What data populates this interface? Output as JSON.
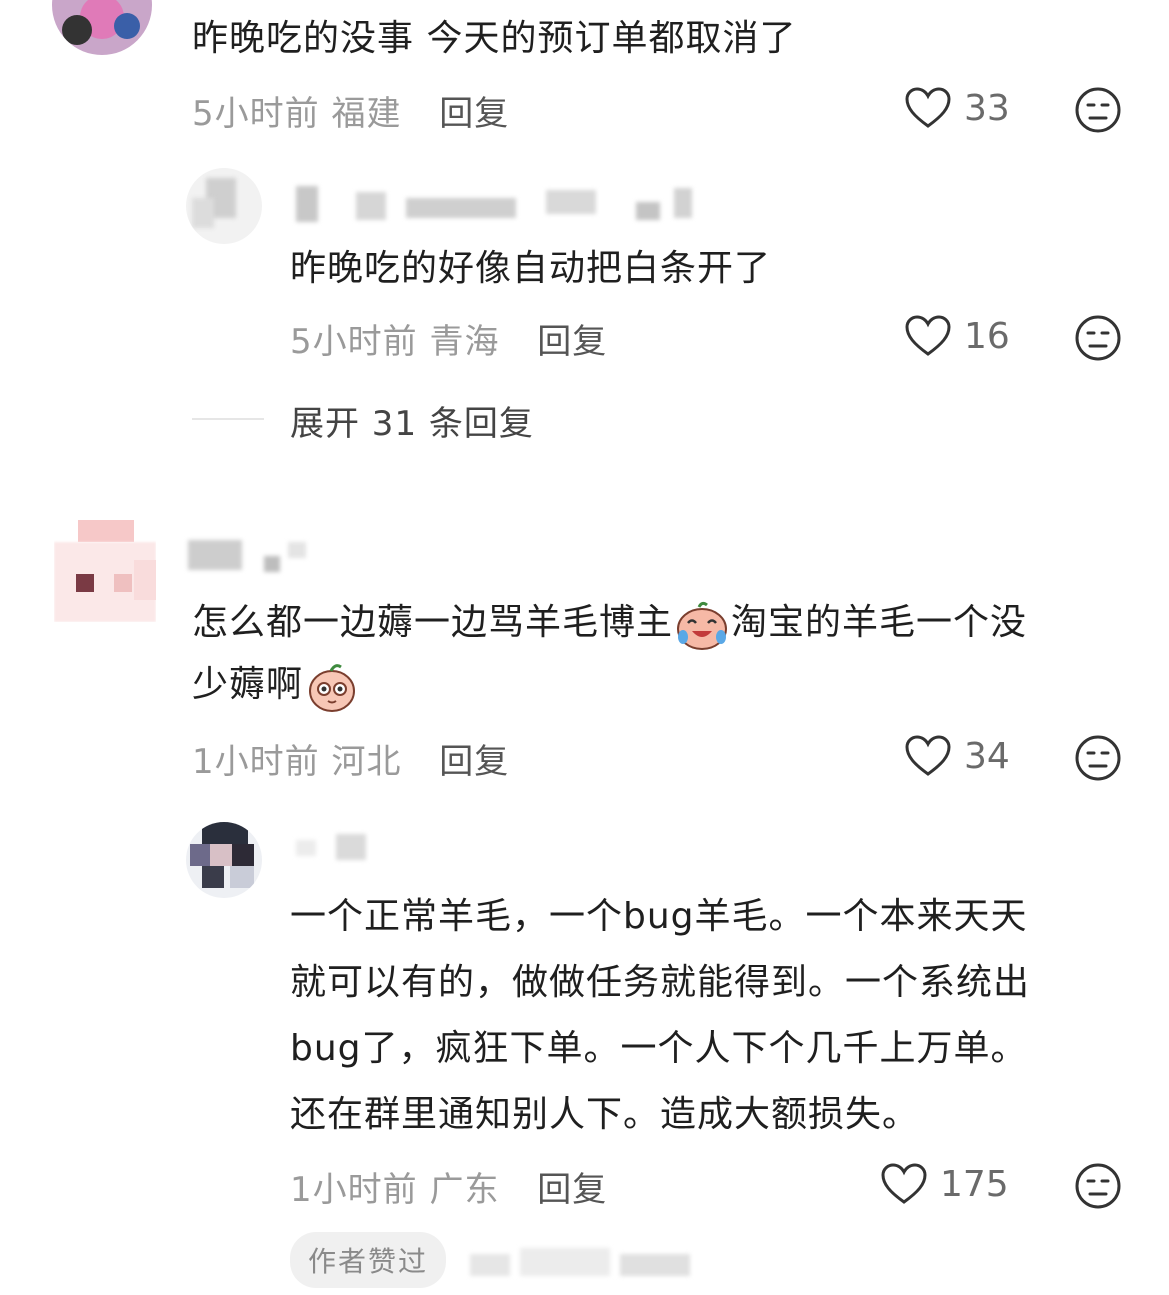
{
  "comments": [
    {
      "text": "昨晚吃的没事 今天的预订单都取消了",
      "time": "5小时前",
      "location": "福建",
      "reply": "回复",
      "likes": "33"
    },
    {
      "text": "昨晚吃的好像自动把白条开了",
      "time": "5小时前",
      "location": "青海",
      "reply": "回复",
      "likes": "16"
    },
    {
      "text_line1": "怎么都一边薅一边骂羊毛博主",
      "text_line1b": "淘宝的羊毛一个没",
      "text_line2": "少薅啊",
      "time": "1小时前",
      "location": "河北",
      "reply": "回复",
      "likes": "34"
    },
    {
      "lines": [
        "一个正常羊毛，一个bug羊毛。一个本来天天",
        "就可以有的，做做任务就能得到。一个系统出",
        "bug了，疯狂下单。一个人下个几千上万单。",
        "还在群里通知别人下。造成大额损失。"
      ],
      "time": "1小时前",
      "location": "广东",
      "reply": "回复",
      "likes": "175",
      "badge": "作者赞过"
    }
  ],
  "expand_replies": "展开 31 条回复",
  "icons": {
    "like": "heart-outline-icon",
    "dislike": "neutral-face-icon",
    "emoji1": "laughing-crying-emoji",
    "emoji2": "shy-peach-emoji"
  }
}
